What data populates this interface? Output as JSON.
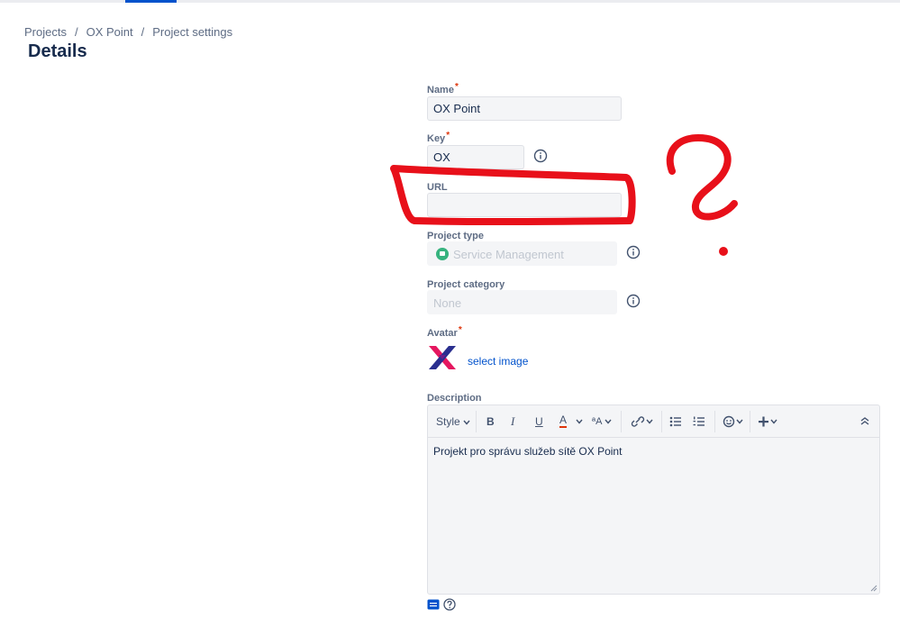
{
  "breadcrumb": {
    "items": [
      "Projects",
      "OX Point",
      "Project settings"
    ],
    "separator": "/"
  },
  "page": {
    "title": "Details"
  },
  "form": {
    "name": {
      "label": "Name",
      "required_mark": "*",
      "value": "OX Point"
    },
    "key": {
      "label": "Key",
      "required_mark": "*",
      "value": "OX"
    },
    "url": {
      "label": "URL",
      "value": ""
    },
    "project_type": {
      "label": "Project type",
      "value": "Service Management"
    },
    "project_category": {
      "label": "Project category",
      "value": "None"
    },
    "avatar": {
      "label": "Avatar",
      "required_mark": "*",
      "link": "select image",
      "logo_letter": "X"
    },
    "description": {
      "label": "Description",
      "toolbar": {
        "style": "Style",
        "bold": "B",
        "italic": "I",
        "underline": "U",
        "text_color": "A",
        "more_format": "ªA"
      },
      "text": "Projekt pro správu služeb sítě OX Point"
    }
  },
  "icons": {
    "info": "info-icon",
    "project_type": "service-management-icon",
    "link": "link-icon",
    "bullet_list": "bullet-list-icon",
    "numbered_list": "numbered-list-icon",
    "emoji": "emoji-icon",
    "insert": "plus-icon",
    "collapse": "collapse-icon",
    "markup": "markup-icon",
    "help": "help-icon"
  },
  "colors": {
    "accent": "#0052cc",
    "required": "#de350b",
    "annotation": "#e8101a",
    "service_management": "#36b37e"
  }
}
